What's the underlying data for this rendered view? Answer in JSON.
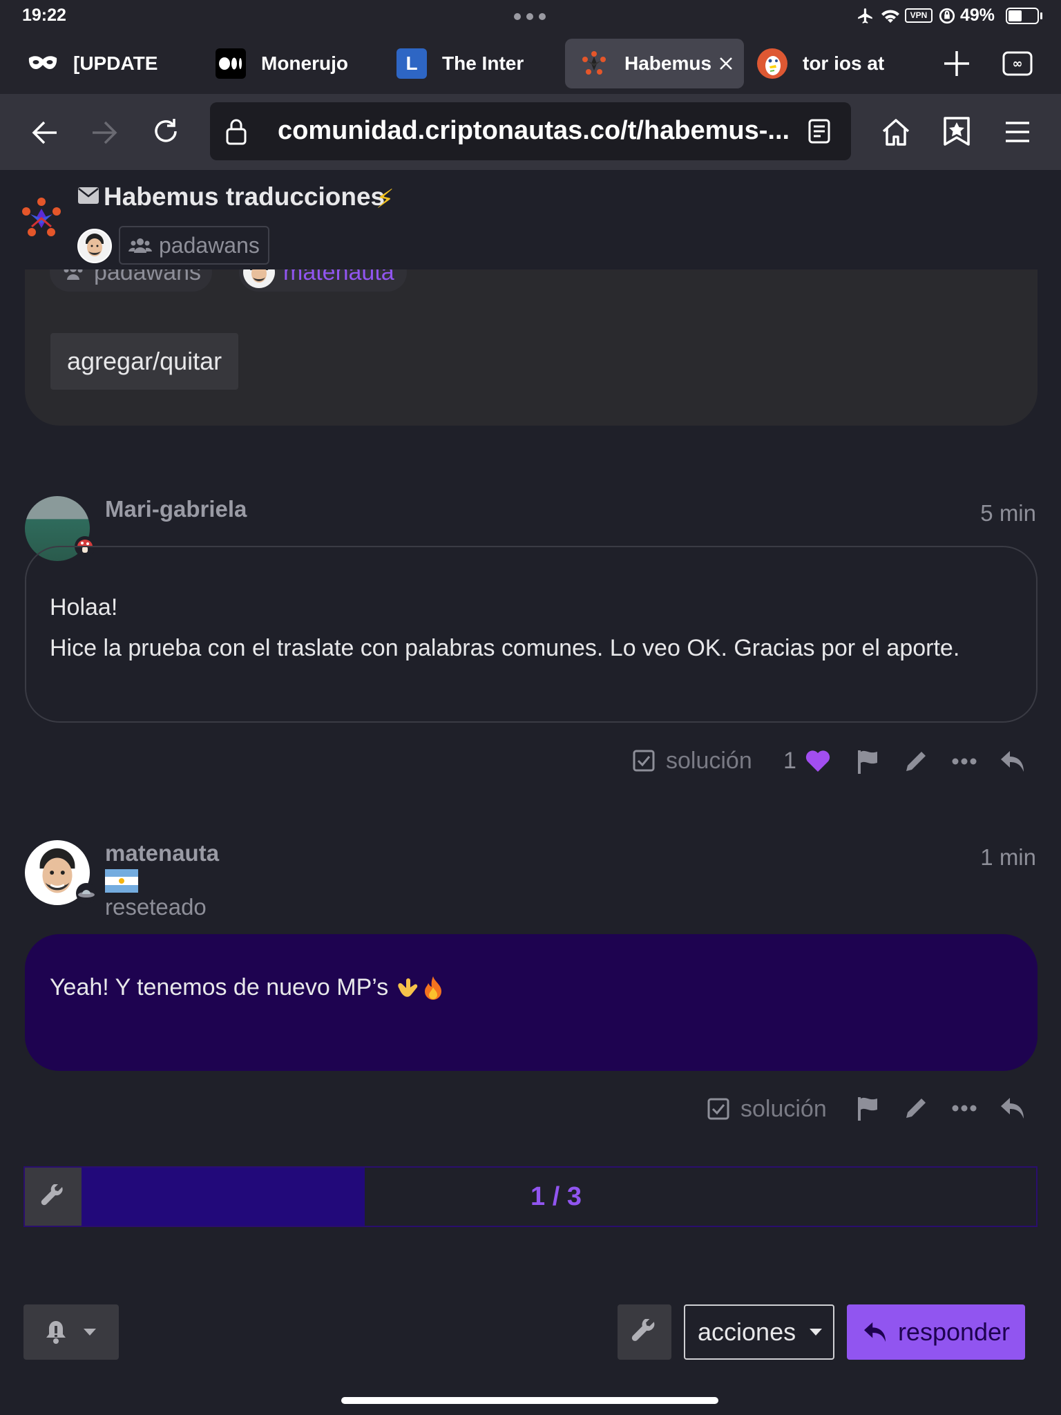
{
  "status_bar": {
    "time": "19:22",
    "battery": "49%",
    "vpn": "VPN"
  },
  "tabs": [
    {
      "label": "[UPDATE",
      "icon": "mask-icon"
    },
    {
      "label": "Monerujo",
      "icon": "medium-icon"
    },
    {
      "label": "The Inter",
      "icon": "l-letter-icon",
      "icon_letter": "L"
    },
    {
      "label": "Habemus",
      "icon": "star-logo-icon",
      "active": true
    },
    {
      "label": "tor ios at",
      "icon": "duckduckgo-icon"
    }
  ],
  "toolbar": {
    "url": "comunidad.criptonautas.co/t/habemus-..."
  },
  "header": {
    "title": "Habemus traducciones",
    "group": "padawans"
  },
  "participants": {
    "group": "padawans",
    "user": "matenauta",
    "button": "agregar/quitar"
  },
  "posts": [
    {
      "username": "Mari-gabriela",
      "time": "5 min",
      "lines": [
        "Holaa!",
        "Hice la prueba con el traslate con palabras comunes. Lo veo OK. Gracias por el aporte."
      ],
      "solution_label": "solución",
      "likes": "1"
    },
    {
      "username": "matenauta",
      "title": "reseteado",
      "time": "1 min",
      "text": "Yeah! Y tenemos de nuevo MP’s",
      "solution_label": "solución"
    }
  ],
  "progress": {
    "label": "1 / 3",
    "fraction": 0.28
  },
  "footer": {
    "actions_label": "acciones",
    "reply_label": "responder"
  },
  "colors": {
    "accent": "#9155f0",
    "own_post_bg": "#1e0350",
    "bg": "#1f2029"
  }
}
